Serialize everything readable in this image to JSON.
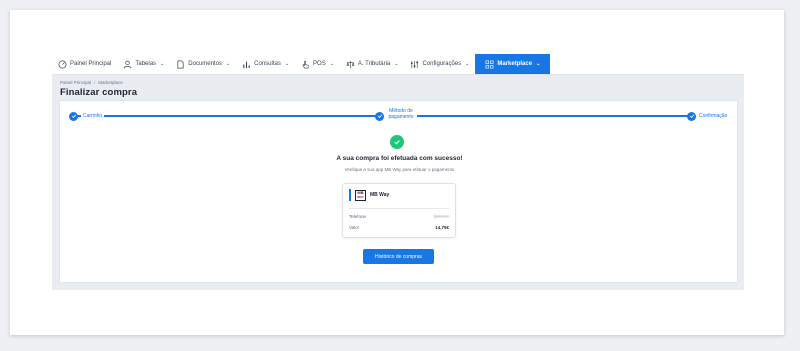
{
  "nav": {
    "items": [
      {
        "label": "Painel Principal",
        "icon": "dashboard-icon",
        "caret": false
      },
      {
        "label": "Tabelas",
        "icon": "users-icon",
        "caret": true
      },
      {
        "label": "Documentos",
        "icon": "document-icon",
        "caret": true
      },
      {
        "label": "Consultas",
        "icon": "bar-chart-icon",
        "caret": true
      },
      {
        "label": "POS",
        "icon": "hand-pointer-icon",
        "caret": true
      },
      {
        "label": "A. Tributária",
        "icon": "tax-icon",
        "caret": true
      },
      {
        "label": "Configurações",
        "icon": "sliders-icon",
        "caret": true
      },
      {
        "label": "Marketplace",
        "icon": "marketplace-icon",
        "caret": true,
        "active": true
      }
    ],
    "caret_char": "⌄"
  },
  "header": {
    "breadcrumb": [
      "Painel Principal",
      "Marketplace"
    ],
    "breadcrumb_sep": "/",
    "title": "Finalizar compra"
  },
  "stepper": {
    "steps": [
      {
        "label": "Carrinho"
      },
      {
        "label": "Método de pagamento"
      },
      {
        "label": "Confirmação"
      }
    ],
    "color": "#1677e5"
  },
  "result": {
    "title": "A sua compra foi efetuada com sucesso!",
    "subtitle": "Verifique a sua app MB Way para efetuar o pagamento",
    "icon": "check-circle-icon",
    "color": "#1fc57a"
  },
  "payment": {
    "logo_top": "MB",
    "logo_bottom": "WAY",
    "method": "MB Way",
    "phone_label": "Telefone",
    "phone_value": "9••••••••",
    "amount_label": "Valor",
    "amount_value": "14,75€"
  },
  "actions": {
    "history_label": "Histórico de compras"
  }
}
